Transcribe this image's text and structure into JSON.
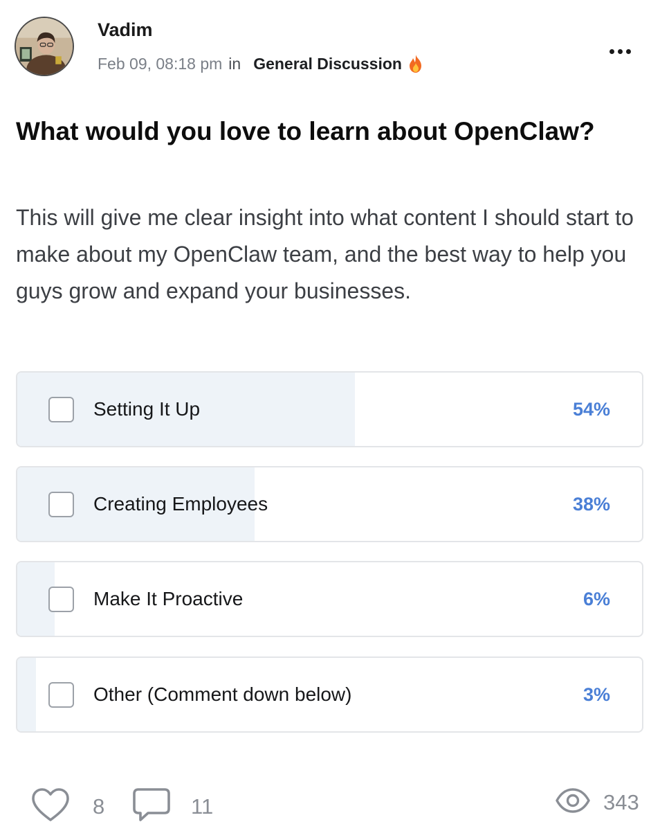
{
  "author": {
    "name": "Vadim",
    "timestamp": "Feb 09, 08:18 pm",
    "in_word": "in",
    "category": "General Discussion",
    "category_icon": "flame-icon"
  },
  "post": {
    "title": "What would you love to learn about OpenClaw?",
    "body": "This will give me clear insight into what content I should start to make about my OpenClaw team, and the best way to help you guys grow and expand your businesses."
  },
  "poll": {
    "options": [
      {
        "label": "Setting It Up",
        "percent_text": "54%",
        "fraction": 0.54
      },
      {
        "label": "Creating Employees",
        "percent_text": "38%",
        "fraction": 0.38
      },
      {
        "label": "Make It Proactive",
        "percent_text": "6%",
        "fraction": 0.06
      },
      {
        "label": "Other (Comment down below)",
        "percent_text": "3%",
        "fraction": 0.03
      }
    ],
    "accent_color": "#4a7fd6",
    "fill_color": "#eef3f8"
  },
  "footer": {
    "likes": "8",
    "comments": "11",
    "views": "343"
  }
}
